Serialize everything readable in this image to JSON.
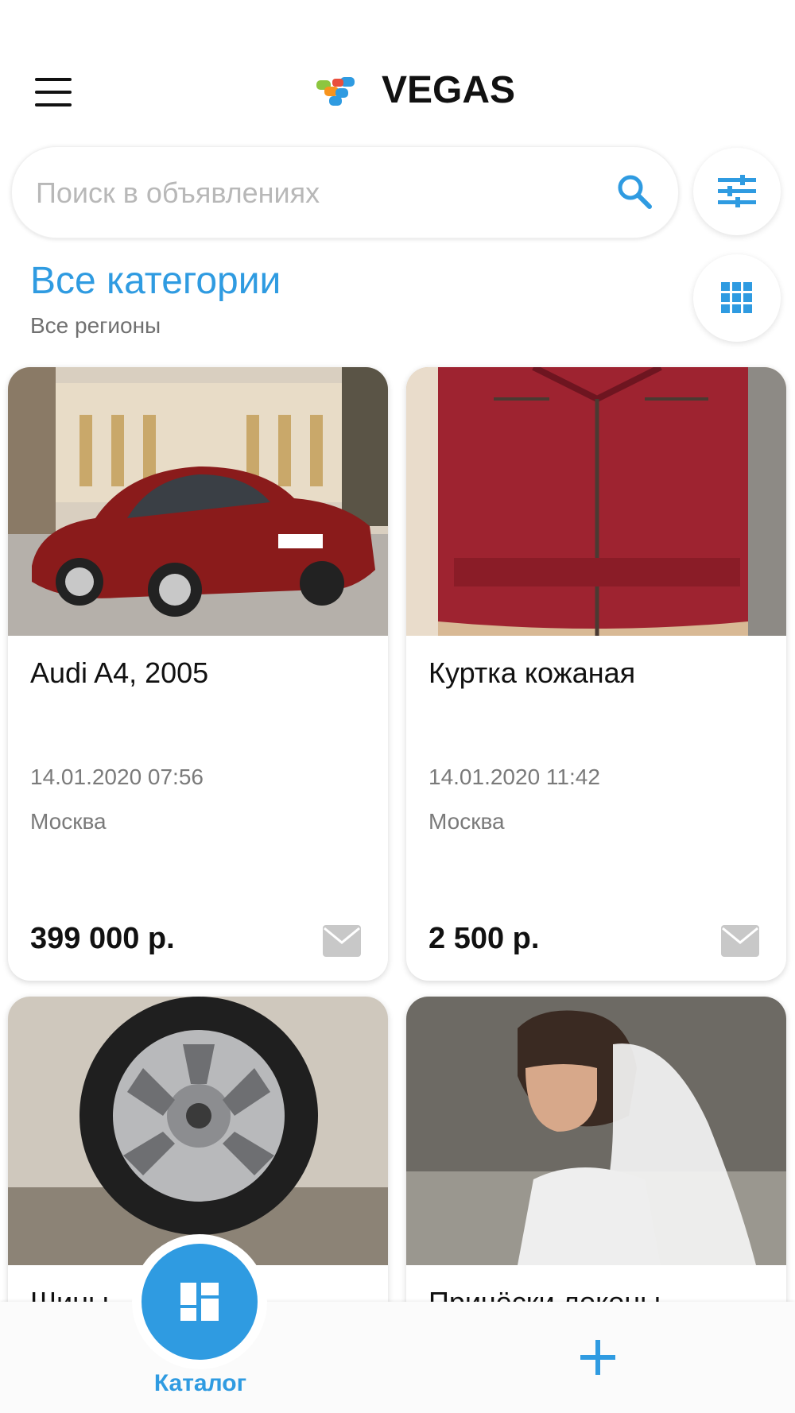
{
  "header": {
    "logo_text": "VEGAS"
  },
  "search": {
    "placeholder": "Поиск в объявлениях"
  },
  "category": {
    "title": "Все категории",
    "region": "Все регионы"
  },
  "listings": [
    {
      "title": "Audi A4, 2005",
      "date": "14.01.2020 07:56",
      "city": "Москва",
      "price": "399 000 р."
    },
    {
      "title": "Куртка кожаная",
      "date": "14.01.2020 11:42",
      "city": "Москва",
      "price": "2 500 р."
    },
    {
      "title": "Шины",
      "date": "",
      "city": "",
      "price": ""
    },
    {
      "title": "Причёски локоны",
      "date": "",
      "city": "",
      "price": ""
    }
  ],
  "bottom_nav": {
    "catalog_label": "Каталог"
  },
  "colors": {
    "accent": "#2f9be1",
    "text": "#111111",
    "muted": "#7a7a7a"
  },
  "icons": [
    "menu-icon",
    "search-icon",
    "filter-icon",
    "grid-icon",
    "mail-icon",
    "catalog-icon",
    "plus-icon"
  ]
}
